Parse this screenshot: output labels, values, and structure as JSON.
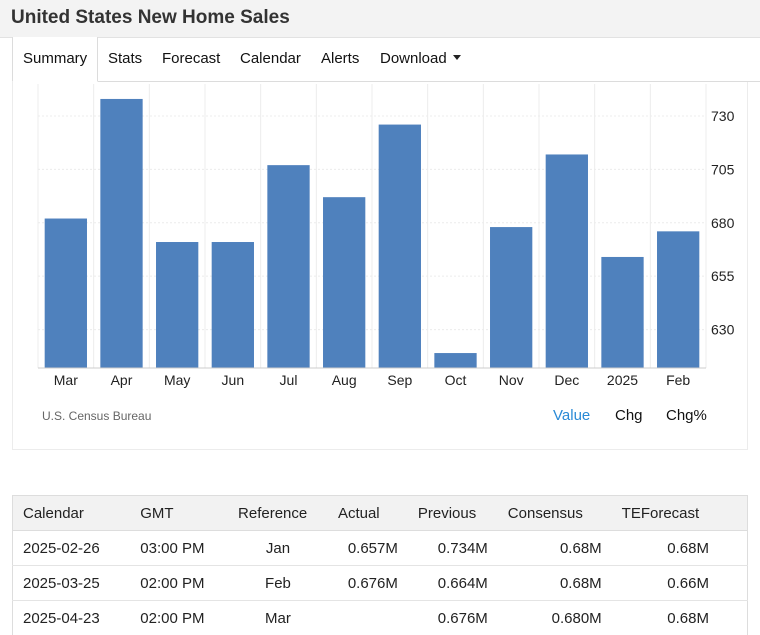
{
  "page": {
    "title": "United States New Home Sales"
  },
  "tabs": [
    {
      "label": "Summary",
      "active": true
    },
    {
      "label": "Stats"
    },
    {
      "label": "Forecast"
    },
    {
      "label": "Calendar"
    },
    {
      "label": "Alerts"
    },
    {
      "label": "Download"
    }
  ],
  "chart_data": {
    "type": "bar",
    "categories": [
      "Mar",
      "Apr",
      "May",
      "Jun",
      "Jul",
      "Aug",
      "Sep",
      "Oct",
      "Nov",
      "Dec",
      "2025",
      "Feb"
    ],
    "values": [
      682,
      738,
      671,
      671,
      707,
      692,
      726,
      619,
      678,
      712,
      664,
      676
    ],
    "yticks": [
      630,
      655,
      680,
      705,
      730
    ],
    "ylim": [
      612,
      745
    ],
    "color": "#4f81bd",
    "grid": true
  },
  "source": "U.S. Census Bureau",
  "toggles": {
    "value": "Value",
    "chg": "Chg",
    "chg_pct": "Chg%"
  },
  "calendar": {
    "headers": [
      "Calendar",
      "GMT",
      "Reference",
      "Actual",
      "Previous",
      "Consensus",
      "TEForecast"
    ],
    "rows": [
      [
        "2025-02-26",
        "03:00 PM",
        "Jan",
        "0.657M",
        "0.734M",
        "0.68M",
        "0.68M"
      ],
      [
        "2025-03-25",
        "02:00 PM",
        "Feb",
        "0.676M",
        "0.664M",
        "0.68M",
        "0.66M"
      ],
      [
        "2025-04-23",
        "02:00 PM",
        "Mar",
        "",
        "0.676M",
        "0.680M",
        "0.68M"
      ]
    ]
  }
}
